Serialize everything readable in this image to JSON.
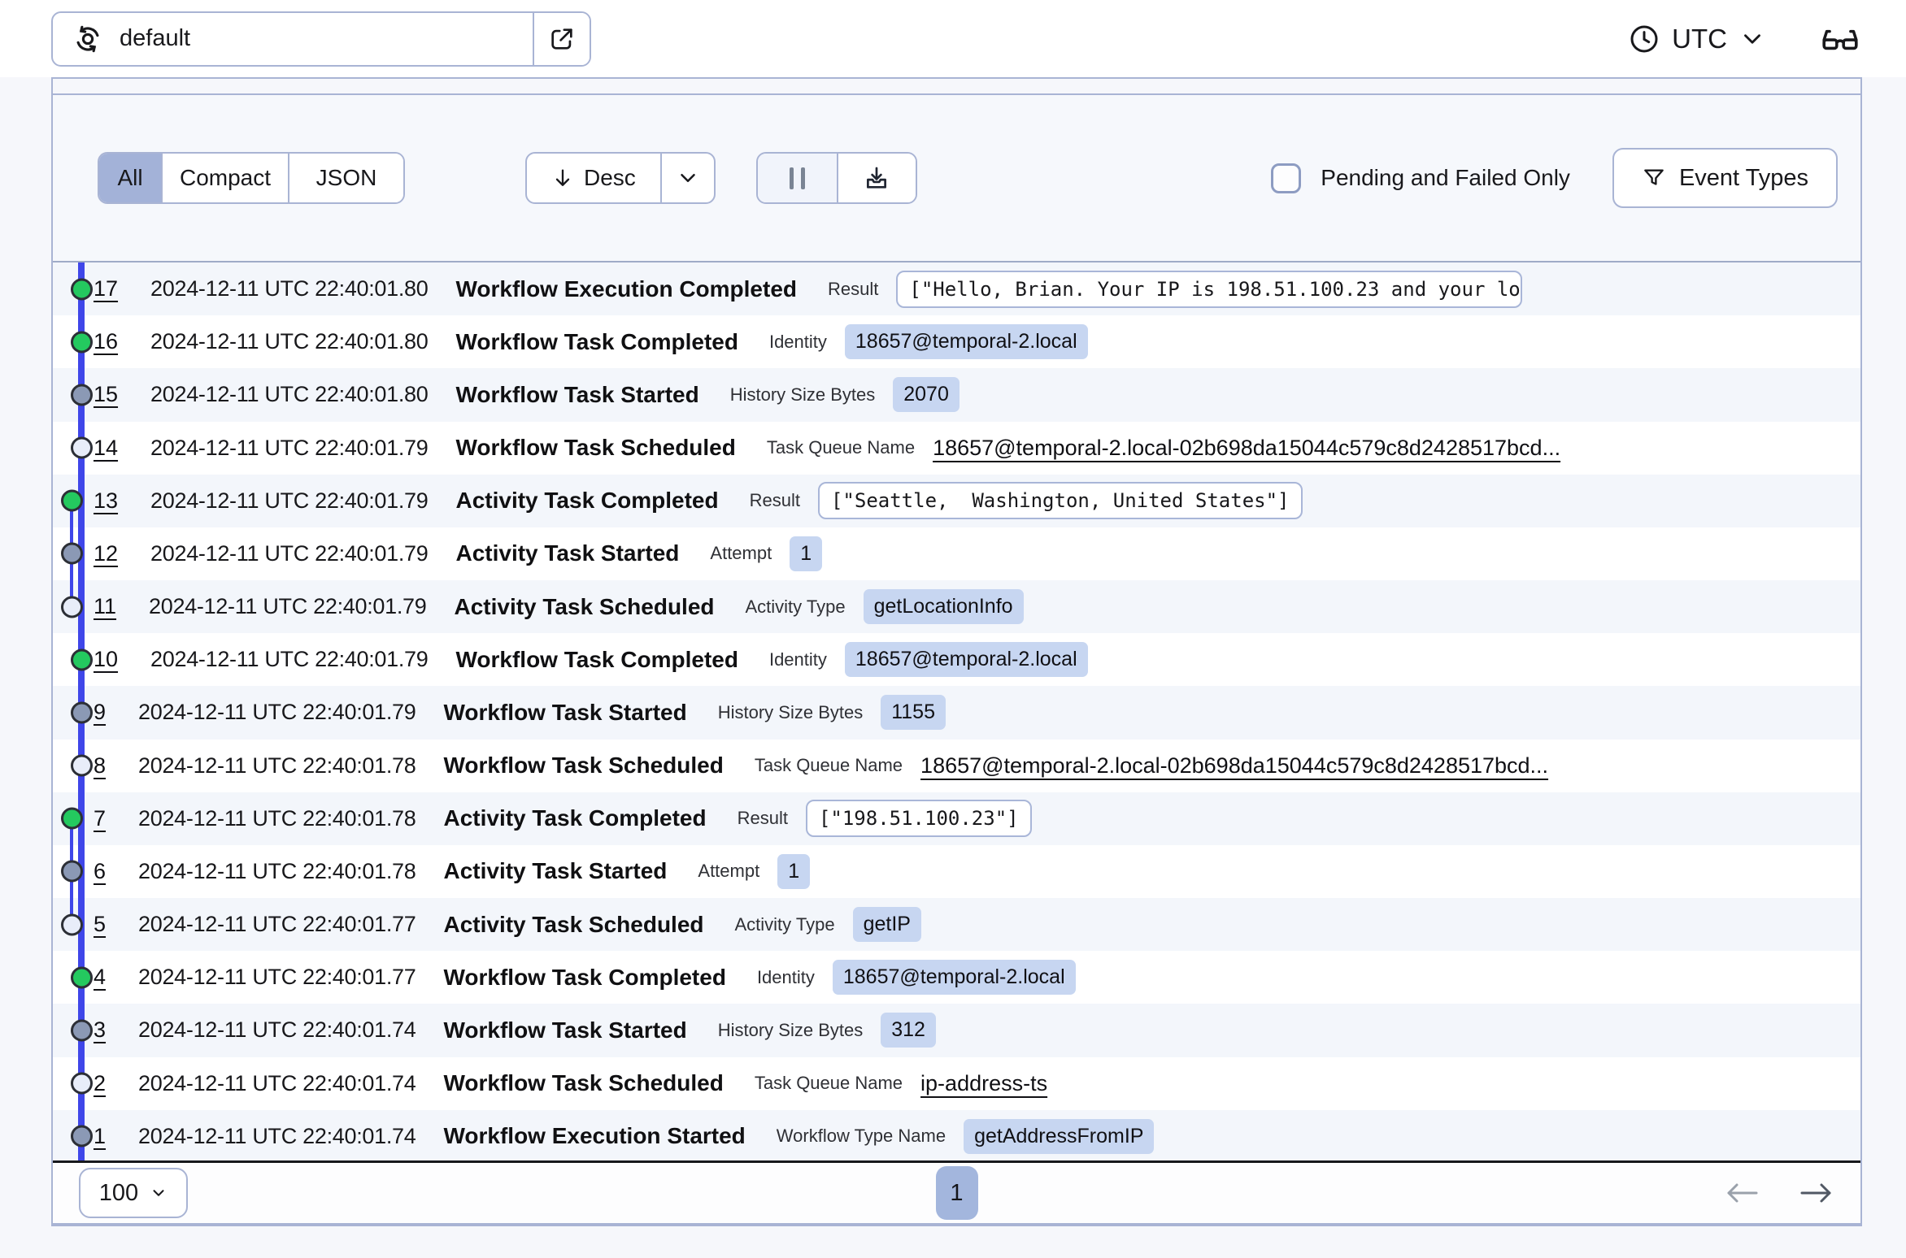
{
  "topbar": {
    "namespace": "default",
    "timezone": "UTC",
    "icons": {
      "namespace_icon": "circular-arrows",
      "open_namespace_icon": "external-link",
      "timezone_icon": "clock",
      "labs_icon": "eyeglasses"
    }
  },
  "toolbar": {
    "view_modes": [
      {
        "label": "All",
        "selected": true
      },
      {
        "label": "Compact",
        "selected": false
      },
      {
        "label": "JSON",
        "selected": false
      }
    ],
    "sort_label": "Desc",
    "sort_direction_icon": "arrow-down",
    "pause_icon": "pause",
    "download_icon": "download",
    "pending_failed_label": "Pending and Failed Only",
    "pending_failed_checked": false,
    "event_types_label": "Event Types",
    "event_types_icon": "filter-funnel"
  },
  "events": [
    {
      "id": "17",
      "time": "2024-12-11 UTC 22:40:01.80",
      "name": "Workflow Execution Completed",
      "detail_label": "Result",
      "detail_value": "[\"Hello, Brian. Your IP is 198.51.100.23 and your lo",
      "value_kind": "box-clipped",
      "dot": "green",
      "activity_offset": false
    },
    {
      "id": "16",
      "time": "2024-12-11 UTC 22:40:01.80",
      "name": "Workflow Task Completed",
      "detail_label": "Identity",
      "detail_value": "18657@temporal-2.local",
      "value_kind": "chip",
      "dot": "green",
      "activity_offset": false
    },
    {
      "id": "15",
      "time": "2024-12-11 UTC 22:40:01.80",
      "name": "Workflow Task Started",
      "detail_label": "History Size Bytes",
      "detail_value": "2070",
      "value_kind": "chip",
      "dot": "gray",
      "activity_offset": false
    },
    {
      "id": "14",
      "time": "2024-12-11 UTC 22:40:01.79",
      "name": "Workflow Task Scheduled",
      "detail_label": "Task Queue Name",
      "detail_value": "18657@temporal-2.local-02b698da15044c579c8d2428517bcd...",
      "value_kind": "link",
      "dot": "hollow",
      "activity_offset": false
    },
    {
      "id": "13",
      "time": "2024-12-11 UTC 22:40:01.79",
      "name": "Activity Task Completed",
      "detail_label": "Result",
      "detail_value": "[\"Seattle,  Washington, United States\"]",
      "value_kind": "box",
      "dot": "green",
      "activity_offset": true
    },
    {
      "id": "12",
      "time": "2024-12-11 UTC 22:40:01.79",
      "name": "Activity Task Started",
      "detail_label": "Attempt",
      "detail_value": "1",
      "value_kind": "chip",
      "dot": "gray",
      "activity_offset": true
    },
    {
      "id": "11",
      "time": "2024-12-11 UTC 22:40:01.79",
      "name": "Activity Task Scheduled",
      "detail_label": "Activity Type",
      "detail_value": "getLocationInfo",
      "value_kind": "chip",
      "dot": "hollow",
      "activity_offset": true
    },
    {
      "id": "10",
      "time": "2024-12-11 UTC 22:40:01.79",
      "name": "Workflow Task Completed",
      "detail_label": "Identity",
      "detail_value": "18657@temporal-2.local",
      "value_kind": "chip",
      "dot": "green",
      "activity_offset": false
    },
    {
      "id": "9",
      "time": "2024-12-11 UTC 22:40:01.79",
      "name": "Workflow Task Started",
      "detail_label": "History Size Bytes",
      "detail_value": "1155",
      "value_kind": "chip",
      "dot": "gray",
      "activity_offset": false
    },
    {
      "id": "8",
      "time": "2024-12-11 UTC 22:40:01.78",
      "name": "Workflow Task Scheduled",
      "detail_label": "Task Queue Name",
      "detail_value": "18657@temporal-2.local-02b698da15044c579c8d2428517bcd...",
      "value_kind": "link",
      "dot": "hollow",
      "activity_offset": false
    },
    {
      "id": "7",
      "time": "2024-12-11 UTC 22:40:01.78",
      "name": "Activity Task Completed",
      "detail_label": "Result",
      "detail_value": "[\"198.51.100.23\"]",
      "value_kind": "box",
      "dot": "green",
      "activity_offset": true
    },
    {
      "id": "6",
      "time": "2024-12-11 UTC 22:40:01.78",
      "name": "Activity Task Started",
      "detail_label": "Attempt",
      "detail_value": "1",
      "value_kind": "chip",
      "dot": "gray",
      "activity_offset": true
    },
    {
      "id": "5",
      "time": "2024-12-11 UTC 22:40:01.77",
      "name": "Activity Task Scheduled",
      "detail_label": "Activity Type",
      "detail_value": "getIP",
      "value_kind": "chip",
      "dot": "hollow",
      "activity_offset": true
    },
    {
      "id": "4",
      "time": "2024-12-11 UTC 22:40:01.77",
      "name": "Workflow Task Completed",
      "detail_label": "Identity",
      "detail_value": "18657@temporal-2.local",
      "value_kind": "chip",
      "dot": "green",
      "activity_offset": false
    },
    {
      "id": "3",
      "time": "2024-12-11 UTC 22:40:01.74",
      "name": "Workflow Task Started",
      "detail_label": "History Size Bytes",
      "detail_value": "312",
      "value_kind": "chip",
      "dot": "gray",
      "activity_offset": false
    },
    {
      "id": "2",
      "time": "2024-12-11 UTC 22:40:01.74",
      "name": "Workflow Task Scheduled",
      "detail_label": "Task Queue Name",
      "detail_value": "ip-address-ts",
      "value_kind": "link",
      "dot": "hollow",
      "activity_offset": false
    },
    {
      "id": "1",
      "time": "2024-12-11 UTC 22:40:01.74",
      "name": "Workflow Execution Started",
      "detail_label": "Workflow Type Name",
      "detail_value": "getAddressFromIP",
      "value_kind": "chip",
      "dot": "gray",
      "activity_offset": false
    }
  ],
  "pagination": {
    "page_size": "100",
    "current_page": "1"
  },
  "colors": {
    "timeline_blue": "#3f46e9",
    "dot_green": "#24c95f",
    "dot_gray": "#8b99b5",
    "dot_hollow": "#e8edf9",
    "chip_bg": "#c7d6f1",
    "panel_border": "#a9b4d4",
    "selected_segment_bg": "#a3b2d8",
    "row_stripe_bg": "#f3f6fb",
    "page_pill_bg": "#a3b6dd"
  }
}
